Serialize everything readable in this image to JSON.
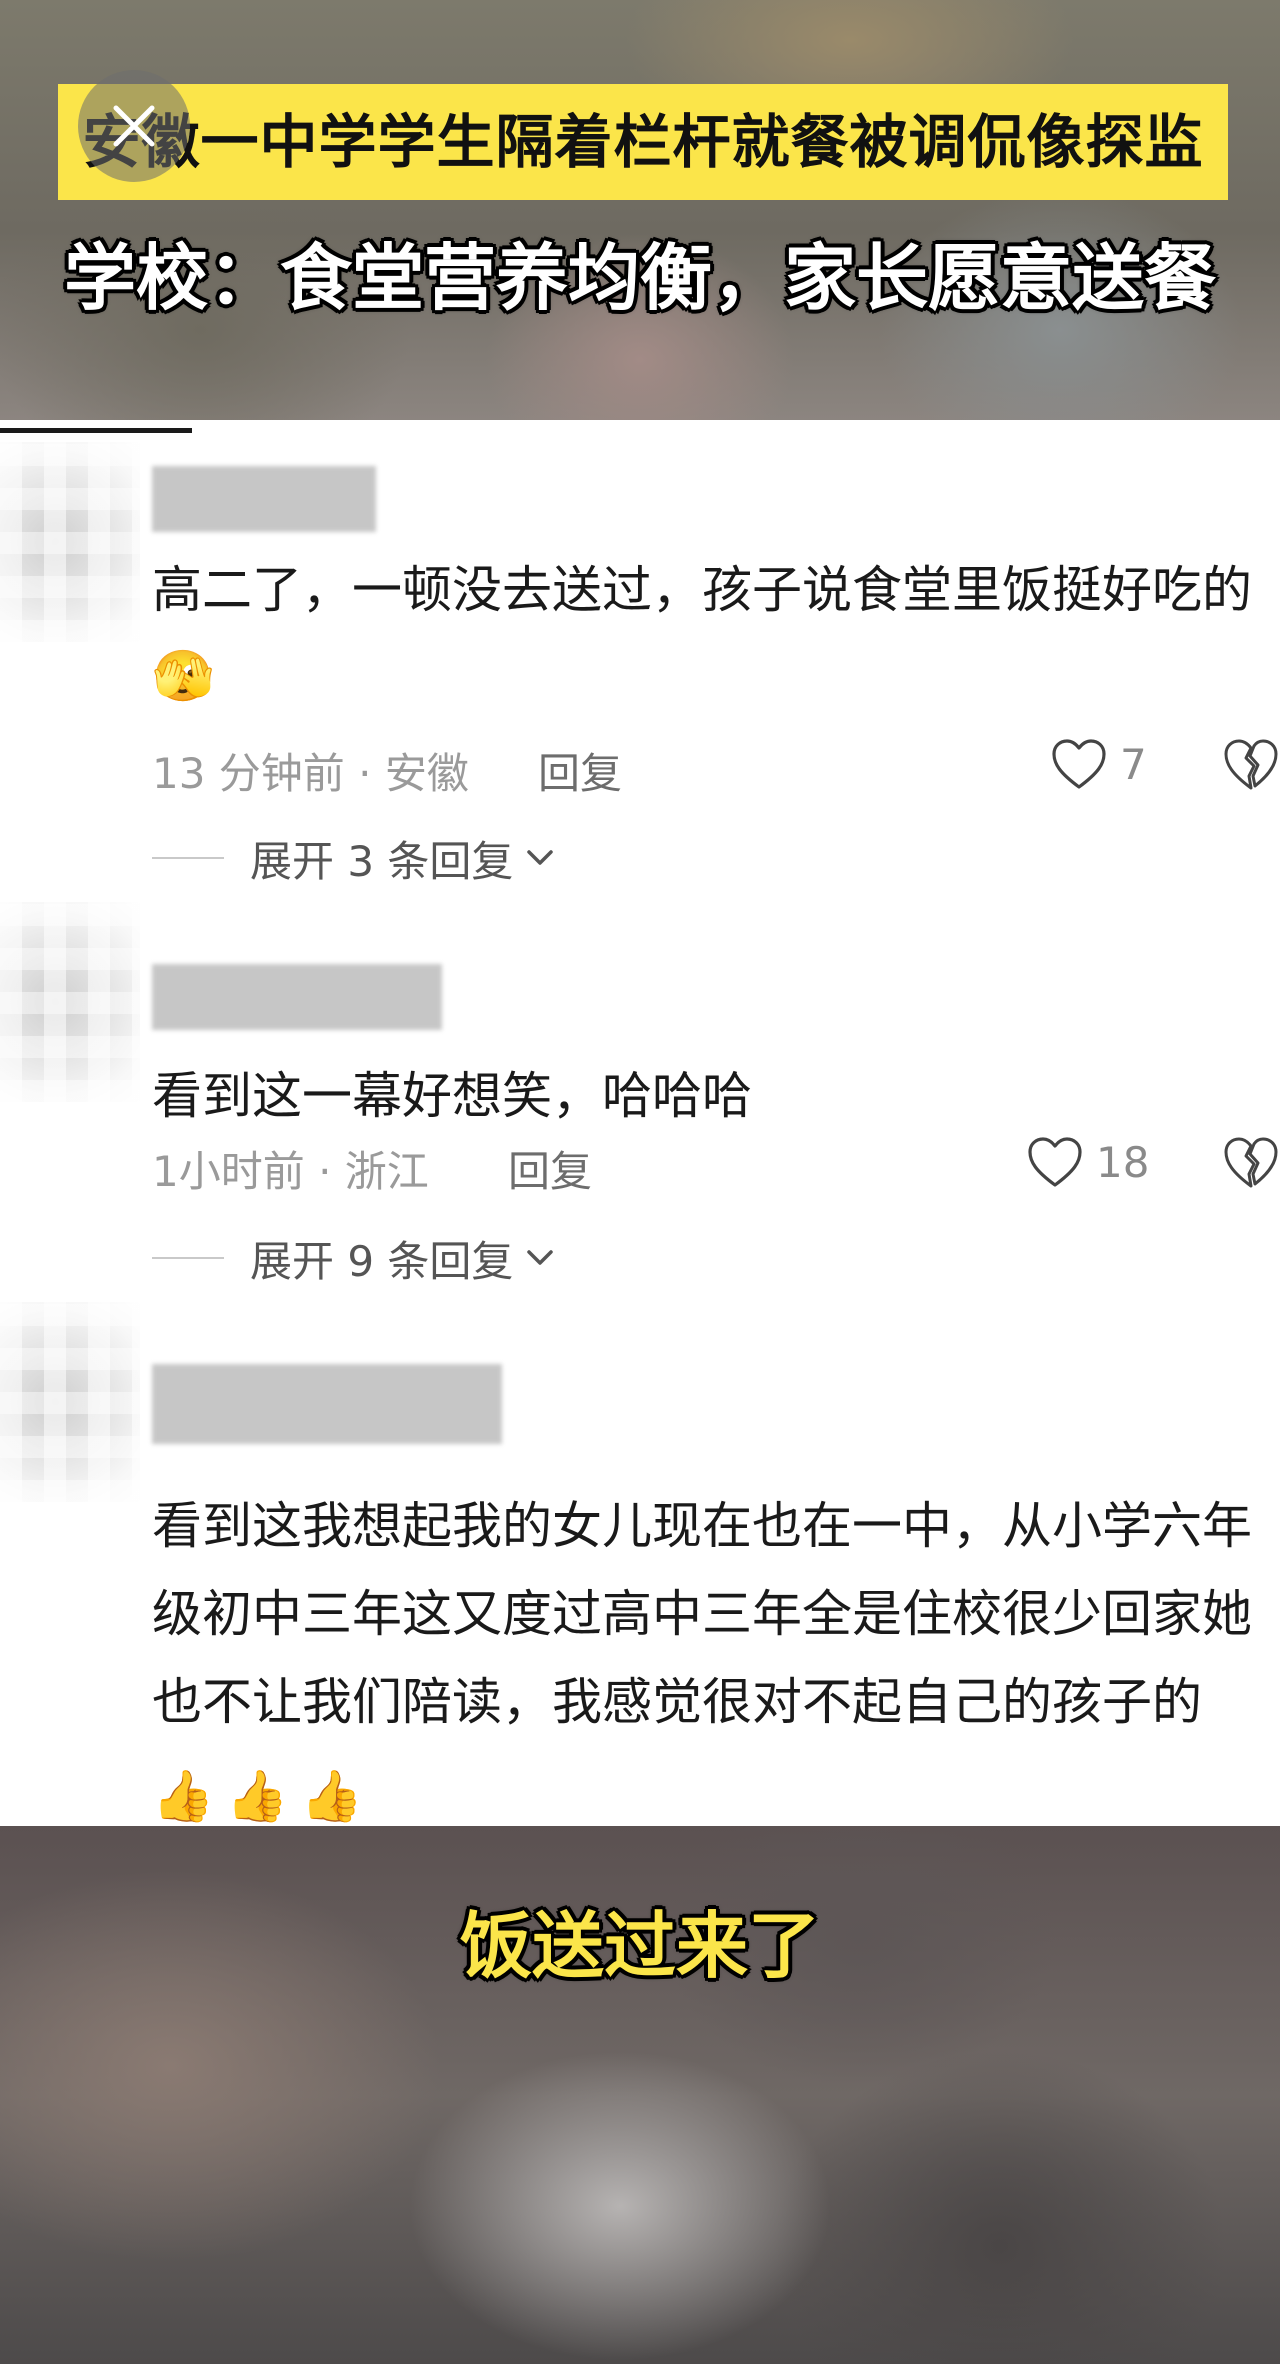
{
  "video_top": {
    "headline": "安徽一中学学生隔着栏杆就餐被调侃像探监",
    "subheadline": "学校：食堂营养均衡，家长愿意送餐"
  },
  "comments": [
    {
      "text": "高二了，一顿没去送过，孩子说食堂里饭挺好吃的",
      "emoji": "🫣",
      "time_location": "13 分钟前 · 安徽",
      "reply_label": "回复",
      "likes": "7",
      "expand_label": "展开 3 条回复"
    },
    {
      "text": "看到这一幕好想笑，哈哈哈",
      "emoji": "",
      "time_location": "1小时前 · 浙江",
      "reply_label": "回复",
      "likes": "18",
      "expand_label": "展开 9 条回复"
    },
    {
      "text": "看到这我想起我的女儿现在也在一中，从小学六年级初中三年这又度过高中三年全是住校很少回家她也不让我们陪读，我感觉很对不起自己的孩子的",
      "emoji": "👍👍👍",
      "time_location": "",
      "reply_label": "",
      "likes": "",
      "expand_label": ""
    }
  ],
  "video_bottom": {
    "subtitle": "饭送过来了"
  },
  "icons": {
    "close": "close-icon",
    "like": "heart-outline-icon",
    "dislike": "broken-heart-icon",
    "expand": "chevron-down-icon"
  },
  "colors": {
    "headline_bg": "#fbe54a",
    "subtitle_text": "#fbe54a",
    "meta_text": "#9a9a9a"
  }
}
